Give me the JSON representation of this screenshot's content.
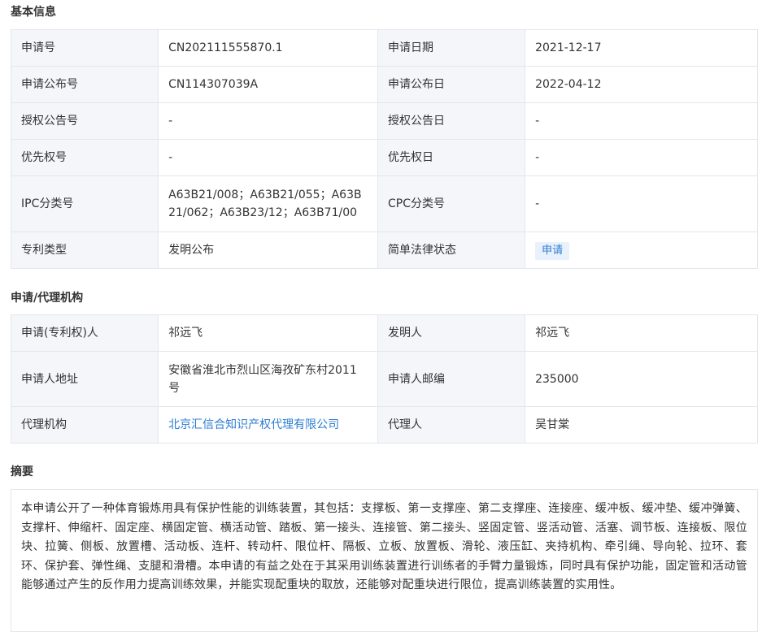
{
  "basic": {
    "title": "基本信息",
    "rows": [
      {
        "l1": "申请号",
        "v1": "CN202111555870.1",
        "l2": "申请日期",
        "v2": "2021-12-17"
      },
      {
        "l1": "申请公布号",
        "v1": "CN114307039A",
        "l2": "申请公布日",
        "v2": "2022-04-12"
      },
      {
        "l1": "授权公告号",
        "v1": "-",
        "l2": "授权公告日",
        "v2": "-"
      },
      {
        "l1": "优先权号",
        "v1": "-",
        "l2": "优先权日",
        "v2": "-"
      },
      {
        "l1": "IPC分类号",
        "v1": "A63B21/008；A63B21/055；A63B21/062；A63B23/12；A63B71/00",
        "l2": "CPC分类号",
        "v2": "-"
      },
      {
        "l1": "专利类型",
        "v1": "发明公布",
        "l2": "简单法律状态",
        "v2": "申请"
      }
    ]
  },
  "agency": {
    "title": "申请/代理机构",
    "rows": [
      {
        "l1": "申请(专利权)人",
        "v1": "祁远飞",
        "l2": "发明人",
        "v2": "祁远飞"
      },
      {
        "l1": "申请人地址",
        "v1": "安徽省淮北市烈山区海孜矿东村2011号",
        "l2": "申请人邮编",
        "v2": "235000"
      },
      {
        "l1": "代理机构",
        "v1": "北京汇信合知识产权代理有限公司",
        "l2": "代理人",
        "v2": "吴甘棠"
      }
    ]
  },
  "abstract": {
    "title": "摘要",
    "text": "本申请公开了一种体育锻炼用具有保护性能的训练装置，其包括：支撑板、第一支撑座、第二支撑座、连接座、缓冲板、缓冲垫、缓冲弹簧、支撑杆、伸缩杆、固定座、横固定管、横活动管、踏板、第一接头、连接管、第二接头、竖固定管、竖活动管、活塞、调节板、连接板、限位块、拉簧、侧板、放置槽、活动板、连杆、转动杆、限位杆、隔板、立板、放置板、滑轮、液压缸、夹持机构、牵引绳、导向轮、拉环、套环、保护套、弹性绳、支腿和滑槽。本申请的有益之处在于其采用训练装置进行训练者的手臂力量锻炼，同时具有保护功能，固定管和活动管能够通过产生的反作用力提高训练效果，并能实现配重块的取放，还能够对配重块进行限位，提高训练装置的实用性。"
  },
  "colors": {
    "link": "#2d7dd2",
    "label_bg": "#f4f6fa",
    "border": "#e3e6ec",
    "badge_bg": "#e8f1fc"
  }
}
